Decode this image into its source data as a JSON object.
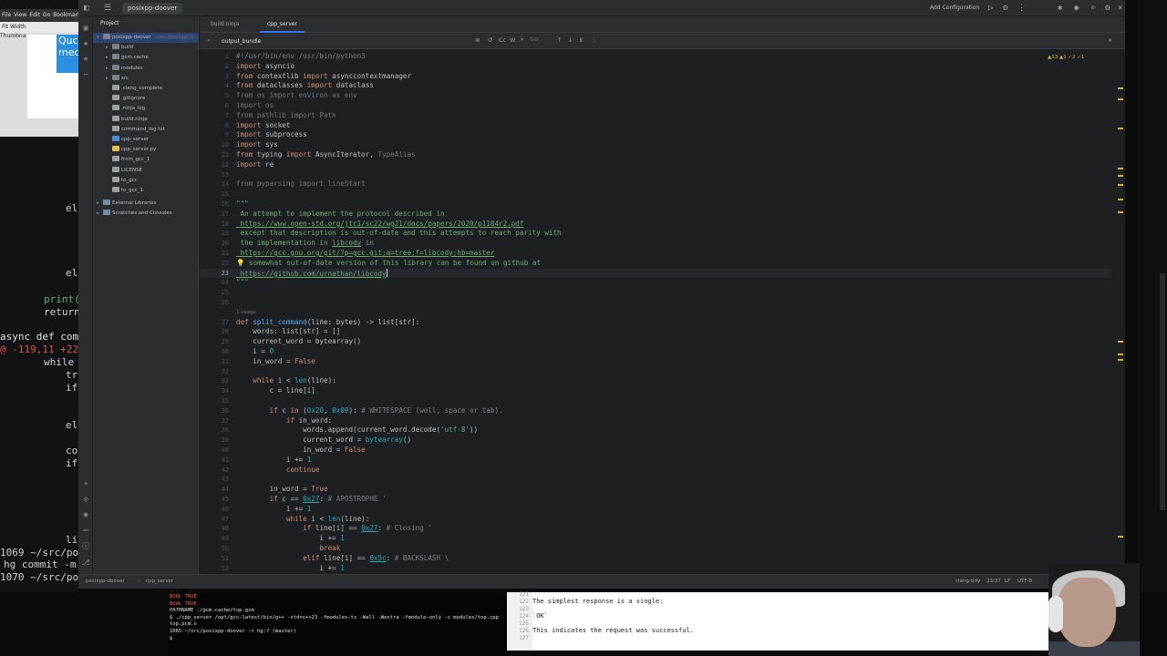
{
  "background_terminal": {
    "window_menu": [
      "File",
      "View",
      "Edit",
      "Go",
      "Bookmarks"
    ],
    "toolbar": "Fit Width",
    "thumbnails_label": "Thumbna",
    "highlight_text": [
      "Quc",
      "mec"
    ],
    "fragments": [
      "el",
      "el",
      "print(",
      "return",
      "async def comp",
      "@ -119,11 +228",
      "while",
      "tr",
      "if",
      "el",
      "co",
      "if",
      "li",
      "1069 ~/src/pos",
      "hg commit -m",
      "1070 ~/src/pos"
    ]
  },
  "ide": {
    "project_name": "posixpp-doover",
    "run_config": "Add Configuration",
    "project_panel_title": "Project",
    "tree": [
      {
        "label": "posixpp-doover",
        "extra": "~/src/posixpp-d",
        "kind": "folder",
        "depth": 0,
        "open": true,
        "selected": true
      },
      {
        "label": "build",
        "kind": "folder",
        "depth": 1,
        "open": false
      },
      {
        "label": "gcm.cache",
        "kind": "folder",
        "depth": 1,
        "open": false
      },
      {
        "label": "modules",
        "kind": "folder",
        "depth": 1,
        "open": false
      },
      {
        "label": "src",
        "kind": "folder",
        "depth": 1,
        "open": false
      },
      {
        "label": ".clang_complete",
        "kind": "txt",
        "depth": 1
      },
      {
        "label": ".gitignore",
        "kind": "txt",
        "depth": 1
      },
      {
        "label": ".ninja_log",
        "kind": "txt",
        "depth": 1
      },
      {
        "label": "build.ninja",
        "kind": "txt",
        "depth": 1
      },
      {
        "label": "command_log.txt",
        "kind": "txt",
        "depth": 1
      },
      {
        "label": "cpp_server",
        "kind": "file",
        "depth": 1
      },
      {
        "label": "cpp_server.py",
        "kind": "py",
        "depth": 1
      },
      {
        "label": "from_gcc_1",
        "kind": "txt",
        "depth": 1
      },
      {
        "label": "LICENSE",
        "kind": "txt",
        "depth": 1
      },
      {
        "label": "to_gcc",
        "kind": "txt",
        "depth": 1
      },
      {
        "label": "to_gcc_1",
        "kind": "txt",
        "depth": 1
      },
      {
        "label": "External Libraries",
        "kind": "lib",
        "depth": 0,
        "open": false
      },
      {
        "label": "Scratches and Consoles",
        "kind": "lib",
        "depth": 0,
        "open": false
      }
    ],
    "tabs": [
      {
        "label": "build.ninja",
        "active": false
      },
      {
        "label": "cpp_server",
        "active": true
      }
    ],
    "find": {
      "query": "output_bundle",
      "case_label": "Cc",
      "word_label": "W",
      "regex_label": ".*",
      "result": "0/0"
    },
    "inspections": "▲13 ▲1 ✓2 ✓1",
    "usage_hint": "1 usage",
    "code_lines": [
      {
        "n": "1",
        "html": "<span class='cmt'>#!/usr/bin/env /usr/bin/python3</span>"
      },
      {
        "n": "2",
        "html": "<span class='kw'>import</span> asyncio"
      },
      {
        "n": "3",
        "html": "<span class='kw'>from</span> contextlib <span class='kw'>import</span> asynccontextmanager"
      },
      {
        "n": "4",
        "html": "<span class='kw'>from</span> dataclasses <span class='kw'>import</span> dataclass"
      },
      {
        "n": "5",
        "html": "<span class='dimc'>from os import environ as env</span>"
      },
      {
        "n": "6",
        "html": "<span class='dimc'>import os</span>"
      },
      {
        "n": "7",
        "html": "<span class='dimc'>from pathlib import Path</span>"
      },
      {
        "n": "8",
        "html": "<span class='kw'>import</span> socket"
      },
      {
        "n": "9",
        "html": "<span class='kw'>import</span> subprocess"
      },
      {
        "n": "10",
        "html": "<span class='kw'>import</span> sys"
      },
      {
        "n": "11",
        "html": "<span class='kw'>from</span> typing <span class='kw'>import</span> AsyncIterator, <span class='dimc'>TypeAlias</span>"
      },
      {
        "n": "12",
        "html": "<span class='kw'>import</span> re"
      },
      {
        "n": "13",
        "html": ""
      },
      {
        "n": "14",
        "html": "<span class='dimc'>from pyparsing import lineStart</span>"
      },
      {
        "n": "15",
        "html": ""
      },
      {
        "n": "16",
        "html": "<span class='str'>\"\"\"</span>"
      },
      {
        "n": "17",
        "html": "<span class='str'> An attempt to implement the protocol described in</span>"
      },
      {
        "n": "18",
        "html": "<span class='link'> https://www.open-std.org/jtc1/sc22/wg21/docs/papers/2020/p1184r2.pdf</span>"
      },
      {
        "n": "19",
        "html": "<span class='str'> except that description is out-of-date and this attempts to reach parity with</span>"
      },
      {
        "n": "20",
        "html": "<span class='str'> the implementation in <u>libcody</u> in</span>"
      },
      {
        "n": "21",
        "html": "<span class='link'> https://gcc.gnu.org/git/?p=gcc.git;a=tree;f=libcody;hb=master</span>"
      },
      {
        "n": "22",
        "html": "<span class='bulb'>💡</span><span class='str'> somewhat out-of-date version of this library can be found on github at</span>"
      },
      {
        "n": "23",
        "html": "<span class='link'> https://github.com/urnathan/libcody</span><span class='caret'></span>",
        "current": true
      },
      {
        "n": "24",
        "html": "<span class='str'>\"\"\"</span>"
      },
      {
        "n": "25",
        "html": ""
      },
      {
        "n": "26",
        "html": ""
      },
      {
        "n": "27",
        "html": "<span class='kw'>def</span> <span class='fn'>split_command</span>(line: bytes) -&gt; list[str]:",
        "hint": true
      },
      {
        "n": "28",
        "html": "    words: list[str] = []"
      },
      {
        "n": "29",
        "html": "    current_word = bytearray()"
      },
      {
        "n": "30",
        "html": "    i = <span class='numv'>0</span>"
      },
      {
        "n": "31",
        "html": "    in_word = <span class='kw'>False</span>"
      },
      {
        "n": "32",
        "html": ""
      },
      {
        "n": "33",
        "html": "    <span class='kw'>while</span> i &lt; <span class='numv'>len</span>(line):"
      },
      {
        "n": "34",
        "html": "        c = line[i]"
      },
      {
        "n": "35",
        "html": ""
      },
      {
        "n": "36",
        "html": "        <span class='kw'>if</span> c <span class='kw'>in</span> (<span class='numv'>0x20</span>, <span class='numv'>0x09</span>): <span class='cmt'># WHITESPACE (well, space or tab).</span>"
      },
      {
        "n": "37",
        "html": "            <span class='kw'>if</span> in_word:"
      },
      {
        "n": "38",
        "html": "                words.append(current_word.decode(<span class='str'>'utf-8'</span>))"
      },
      {
        "n": "39",
        "html": "                current_word = <span class='numv'>bytearray</span>()"
      },
      {
        "n": "40",
        "html": "                in_word = <span class='kw'>False</span>"
      },
      {
        "n": "41",
        "html": "            i += <span class='numv'>1</span>"
      },
      {
        "n": "42",
        "html": "            <span class='kw'>continue</span>"
      },
      {
        "n": "43",
        "html": ""
      },
      {
        "n": "44",
        "html": "        in_word = <span class='kw'>True</span>"
      },
      {
        "n": "45",
        "html": "        <span class='kw'>if</span> c == <u class='numv'>0x27</u>: <span class='cmt'># APOSTROPHE '</span>"
      },
      {
        "n": "46",
        "html": "            i += <span class='numv'>1</span>"
      },
      {
        "n": "47",
        "html": "            <span class='kw'>while</span> i &lt; <span class='numv'>len</span>(line):"
      },
      {
        "n": "48",
        "html": "                <span class='kw'>if</span> line[i] == <u class='numv'>0x27</u>: <span class='cmt'># Closing '</span>"
      },
      {
        "n": "49",
        "html": "                    i += <span class='numv'>1</span>"
      },
      {
        "n": "50",
        "html": "                    <span class='kw'>break</span>"
      },
      {
        "n": "51",
        "html": "                <span class='kw'>elif</span> line[i] == <u class='numv'>0x5c</u>: <span class='cmt'># BACKSLASH \\</span>"
      },
      {
        "n": "52",
        "html": "                    i += <span class='numv'>1</span>"
      }
    ],
    "status": {
      "breadcrumb_project": "posixpp-doover",
      "breadcrumb_file": "cpp_server",
      "language": "clang-tidy",
      "position": "23:37",
      "line_sep": "LF",
      "encoding": "UTF-8"
    }
  },
  "bottom_terminal": {
    "lines": [
      "BOOL TRUE",
      "BOOL TRUE",
      "PATHNAME ./gcm.cache/top.gcm",
      "$ ./cpp_server /opt/gcc-latest/bin/g++ -std=c++23 -fmodules-ts -Wall -Wextra -fmodule-only -c modules/top.cpp",
      "top.pcm.o",
      "1065 ~/src/posixpp-doover -> hg:? (master)",
      "$"
    ]
  },
  "doc_viewer": {
    "lines": [
      {
        "n": "121",
        "t": ""
      },
      {
        "n": "122",
        "t": "The simplest response is a single:"
      },
      {
        "n": "123",
        "t": ""
      },
      {
        "n": "124",
        "t": "`OK`"
      },
      {
        "n": "125",
        "t": ""
      },
      {
        "n": "126",
        "t": "This indicates the request was successful."
      },
      {
        "n": "127",
        "t": ""
      }
    ]
  },
  "colors": {
    "editor_bg": "#1e1f22",
    "panel_bg": "#2b2d30",
    "keyword": "#cf8e6d",
    "string": "#6aab73",
    "function": "#56a8f5",
    "number": "#2aacb8",
    "comment": "#7a7e85",
    "accent": "#3574f0"
  }
}
